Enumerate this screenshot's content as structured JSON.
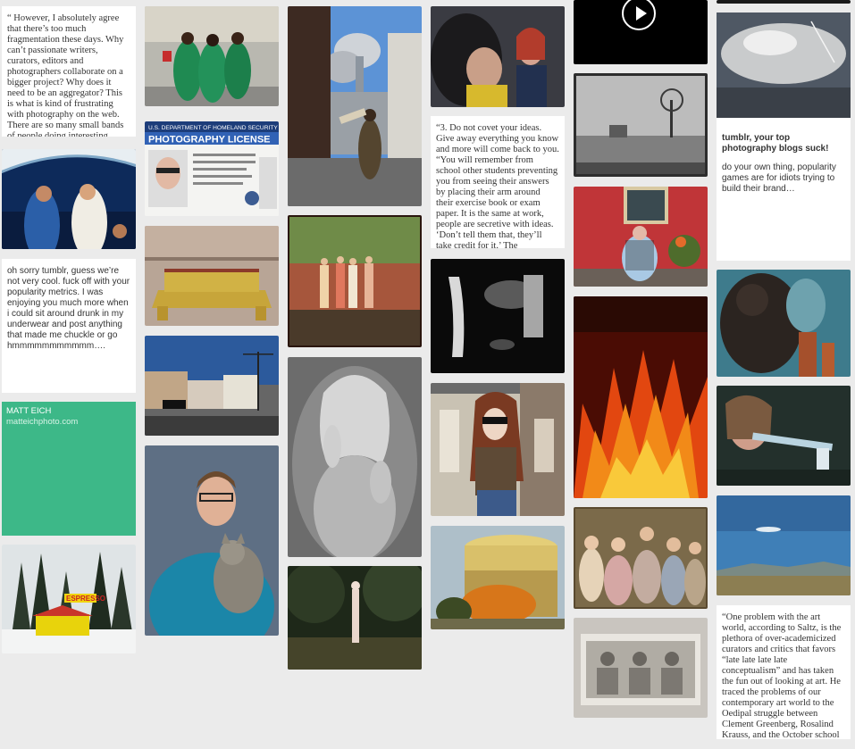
{
  "posts": {
    "quote_fragmentation": "“ However, I absolutely agree that there’s too much fragmentation these days. Why can’t passionate writers, curators, editors and photographers collaborate on a bigger project? Why does it need to be an aggregator? This is what is kind of frustrating with photography on the web. There are so many small bands of people doing interesting",
    "note_sorry": "oh sorry tumblr, guess we’re not very cool. fuck off with your popularity metrics. I was enjoying you much more when i could sit around drunk in my underwear and post anything that made me chuckle or go hmmmmmmmmmmm….",
    "matt_name": "MATT EICH",
    "matt_site": "matteichphoto.com",
    "license_agency": "U.S. DEPARTMENT OF HOMELAND SECURITY",
    "license_title": "PHOTOGRAPHY LICENSE",
    "espresso_sign": "ESPRESSO",
    "quote_covet": "“3. Do not covet your ideas. Give away everything you know and more will come back to you. “You will remember from school other students preventing you from seeing their answers by placing their arm around their exercise book or exam paper. It is the same at work, people are secretive with ideas. ‘Don’t tell them that, they’ll take credit for it.’ The",
    "tumblr_title": "tumblr, your top photography blogs suck!",
    "tumblr_body": "do your own thing, popularity games are for idiots trying to build their brand…",
    "quote_art": "“One problem with the art world, according to Saltz, is the plethora of over-academicized curators and critics that favors “late late late late conceptualism” and has taken the fun out of looking at art. He traced the problems of our contemporary art world to the Oedipal struggle between Clement Greenberg, Rosalind Krauss, and the October school"
  },
  "icons": {
    "video_play": "play-icon"
  }
}
